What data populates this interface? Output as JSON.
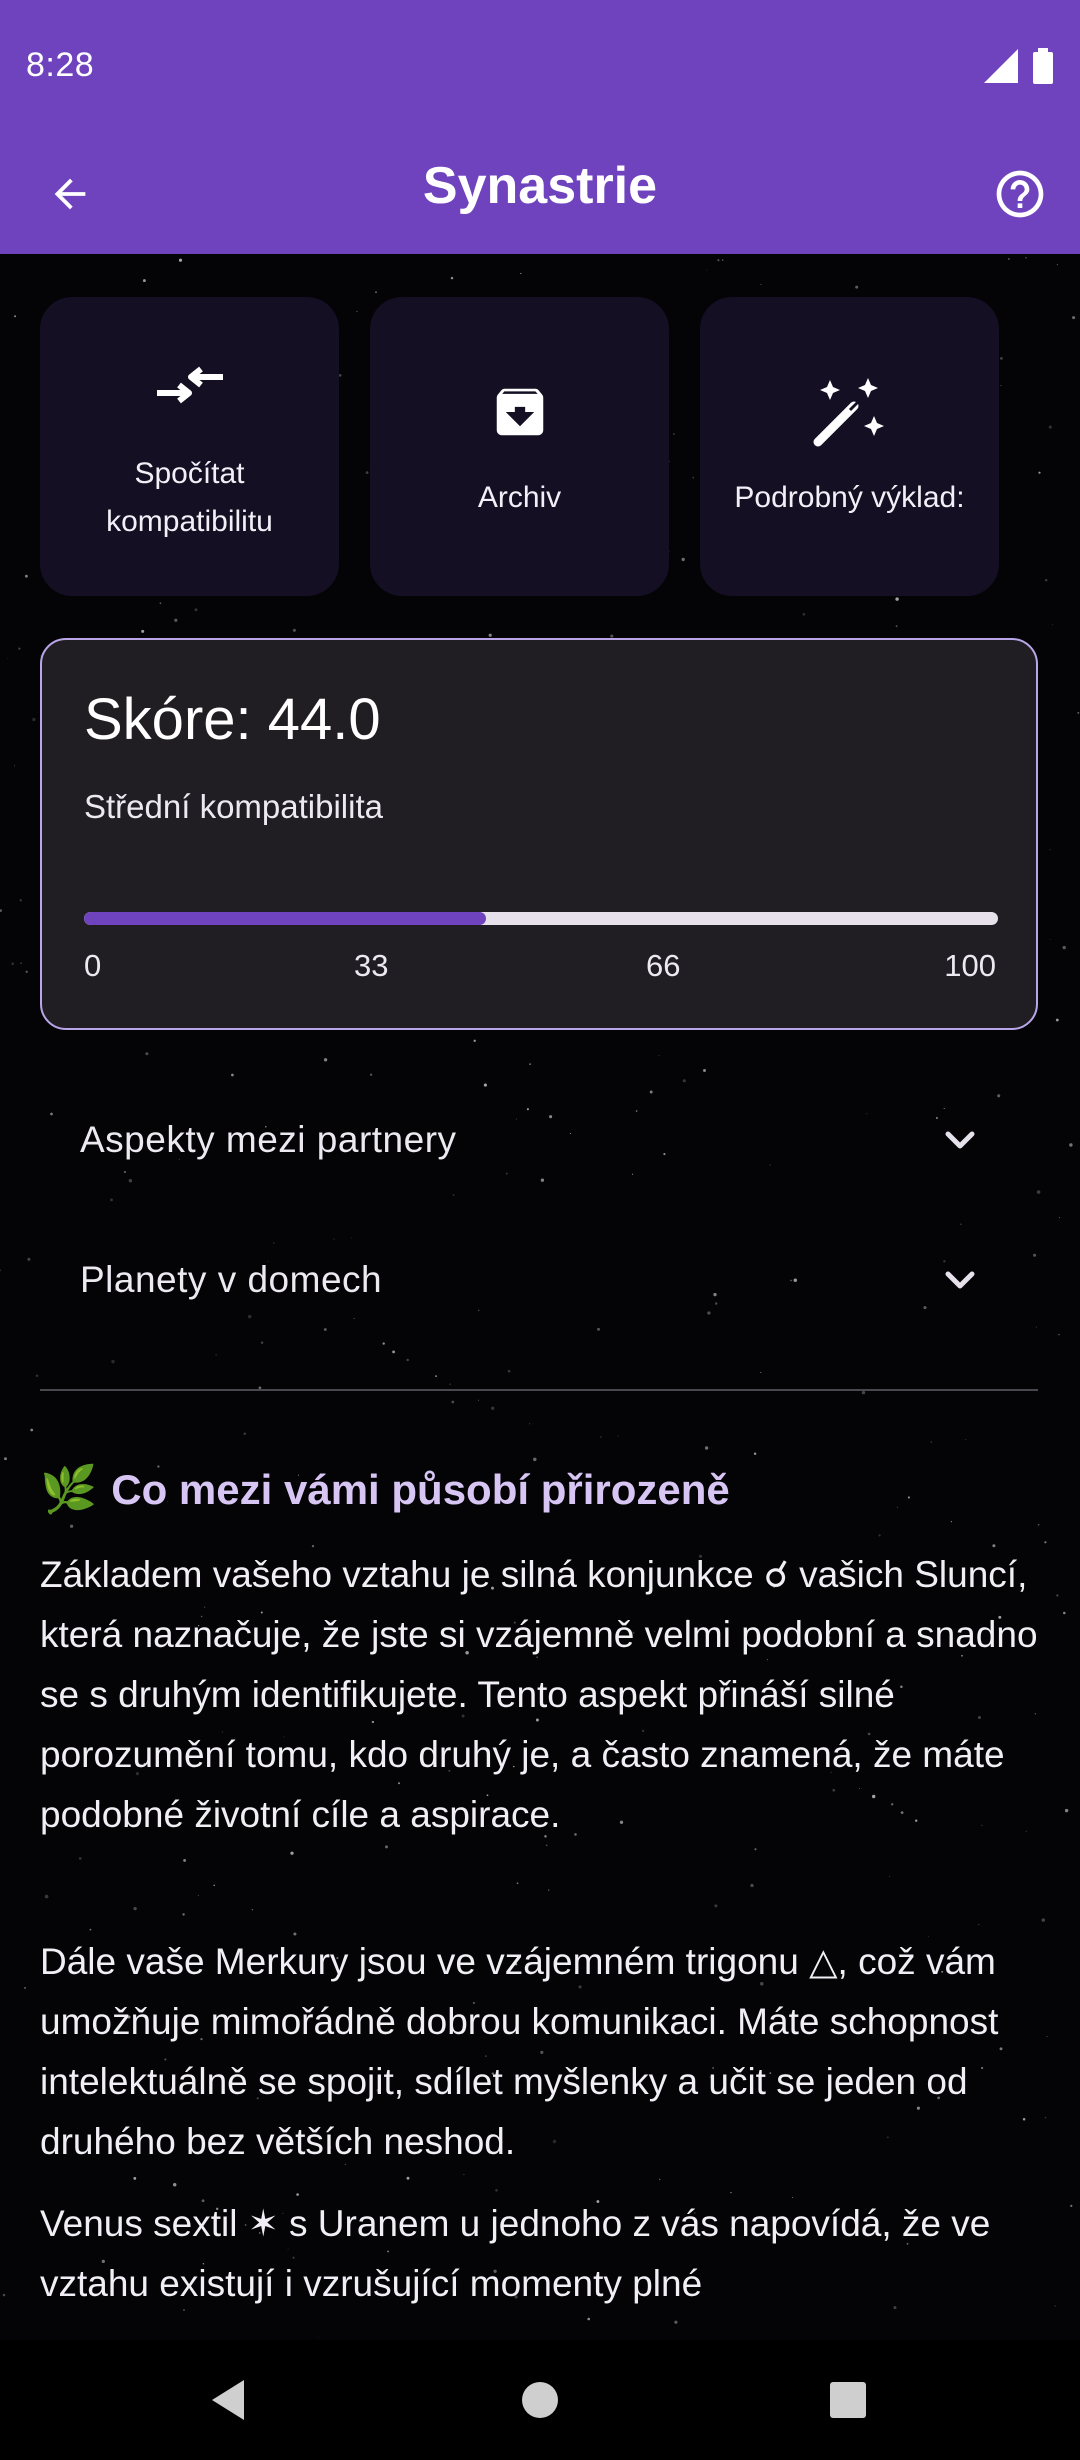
{
  "status_bar": {
    "time": "8:28",
    "icons": [
      "signal-icon",
      "battery-icon"
    ]
  },
  "app_bar": {
    "title": "Synastrie",
    "back_icon": "arrow-back-icon",
    "help_icon": "help-circle-icon",
    "background": "#6f43bd"
  },
  "actions": [
    {
      "label": "Spočítat kompatibilitu",
      "icon": "compare-arrows-icon"
    },
    {
      "label": "Archiv",
      "icon": "archive-icon"
    },
    {
      "label": "Podrobný výklad:",
      "icon": "magic-wand-icon"
    }
  ],
  "score": {
    "title": "Skóre: 44.0",
    "subtitle": "Střední kompatibilita",
    "value": 44.0,
    "max": 100,
    "ticks": [
      "0",
      "33",
      "66",
      "100"
    ],
    "fill_color": "#6f43bd"
  },
  "expanders": [
    {
      "label": "Aspekty mezi partnery",
      "icon": "chevron-down-icon"
    },
    {
      "label": "Planety v domech",
      "icon": "chevron-down-icon"
    }
  ],
  "interpretation": {
    "heading_icon": "🌿",
    "heading": "Co mezi vámi působí přirozeně",
    "paragraphs": [
      "Základem vašeho vztahu je silná konjunkce ☌ vašich Sluncí, která naznačuje, že jste si vzájemně velmi podobní a snadno se s druhým identifikujete. Tento aspekt přináší silné porozumění tomu, kdo druhý je, a často znamená, že máte podobné životní cíle a aspirace.",
      "Dále vaše Merkury jsou ve vzájemném trigonu △, což vám umožňuje mimořádně dobrou komunikaci. Máte schopnost intelektuálně se spojit, sdílet myšlenky a učit se jeden od druhého bez větších neshod.",
      "Venus sextil ✶ s Uranem u jednoho z vás napovídá, že ve vztahu existují i vzrušující momenty plné"
    ]
  },
  "nav_bar": {
    "buttons": [
      "back-triangle-icon",
      "home-circle-icon",
      "recents-square-icon"
    ]
  }
}
